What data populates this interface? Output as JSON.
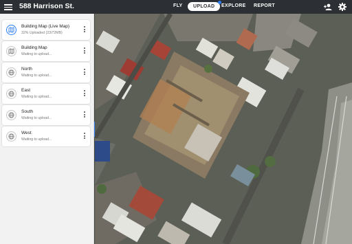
{
  "header": {
    "title": "588 Harrison St.",
    "tabs": [
      {
        "label": "FLY",
        "active": false
      },
      {
        "label": "UPLOAD",
        "active": true
      },
      {
        "label": "EXPLORE",
        "active": false
      },
      {
        "label": "REPORT",
        "active": false
      }
    ],
    "icons": [
      "menu-icon",
      "add-user-icon",
      "gear-icon"
    ]
  },
  "sidebar": {
    "items": [
      {
        "title": "Building Map (Live Map)",
        "status": "32% Uploaded (23/72MB)",
        "progress": 0.32,
        "icon": "map-icon",
        "accent": "#2d7ff9"
      },
      {
        "title": "Building Map",
        "status": "Waiting to upload...",
        "icon": "map-icon"
      },
      {
        "title": "North",
        "status": "Waiting to upload...",
        "icon": "globe-icon"
      },
      {
        "title": "East",
        "status": "Waiting to upload...",
        "icon": "globe-icon"
      },
      {
        "title": "South",
        "status": "Waiting to upload...",
        "icon": "globe-icon"
      },
      {
        "title": "West",
        "status": "Waiting to upload...",
        "icon": "globe-icon"
      }
    ]
  },
  "colors": {
    "topbar": "#2c2f33",
    "accent": "#2d7ff9",
    "sidebar": "#f2f2f2"
  }
}
